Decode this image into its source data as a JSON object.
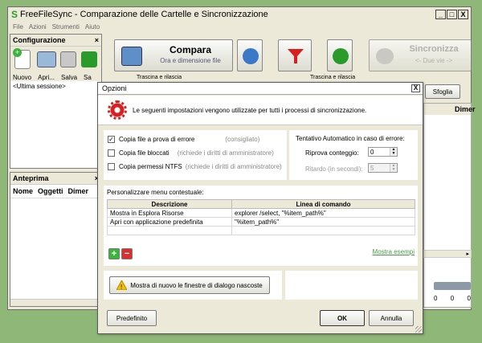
{
  "app": {
    "logo": "S",
    "title": "FreeFileSync - Comparazione delle Cartelle e Sincronizzazione"
  },
  "menu": [
    "File",
    "Azioni",
    "Strumenti",
    "Aiuto"
  ],
  "window_buttons": [
    "_",
    "□",
    "X"
  ],
  "config_panel": {
    "title": "Configurazione",
    "close": "×",
    "buttons": [
      "Nuovo",
      "Apri...",
      "Salva",
      "Sa"
    ],
    "session": "<Ultima sessione>"
  },
  "preview_panel": {
    "title": "Anteprima",
    "close": "×",
    "columns": [
      "Nome",
      "Oggetti",
      "Dimer"
    ]
  },
  "toolbar": {
    "compare_label": "Compara",
    "compare_sub": "Ora e dimensione file",
    "sync_label": "Sincronizza",
    "sync_sub": "<- Due vie ->"
  },
  "folder_bar": {
    "left": "Trascina e rilascia",
    "right": "Trascina e rilascia",
    "browse": "Sfoglia",
    "col": "Dimer"
  },
  "stats": {
    "values": [
      "0",
      "0",
      "0"
    ]
  },
  "dialog": {
    "title": "Opzioni",
    "close": "X",
    "intro": "Le seguenti impostazioni vengono utilizzate per tutti i processi di sincronizzazione.",
    "options": [
      {
        "label": "Copia file a prova di errore",
        "hint": "(consigliato)",
        "checked": "✓"
      },
      {
        "label": "Copia file bloccati",
        "hint": "(richiede i diritti di amministratore)",
        "checked": ""
      },
      {
        "label": "Copia permessi NTFS",
        "hint": "(richiede i diritti di amministratore)",
        "checked": ""
      }
    ],
    "retry": {
      "title": "Tentativo Automatico in caso di errore:",
      "count_label": "Riprova conteggio:",
      "count_value": "0",
      "delay_label": "Ritardo (in secondi):",
      "delay_value": "5"
    },
    "context": {
      "title": "Personalizzare menu contestuale:",
      "headers": [
        "Descrizione",
        "Linea di comando"
      ],
      "rows": [
        [
          "Mostra in Esplora Risorse",
          "explorer /select, \"%item_path%\""
        ],
        [
          "Apri con applicazione predefinita",
          "\"%item_path%\""
        ],
        [
          "",
          ""
        ]
      ],
      "add": "+",
      "remove": "−",
      "examples": "Mostra esempi"
    },
    "show_hidden": "Mostra di nuovo le finestre di dialogo nascoste",
    "default_btn": "Predefinito",
    "ok_btn": "OK",
    "cancel_btn": "Annulla"
  }
}
